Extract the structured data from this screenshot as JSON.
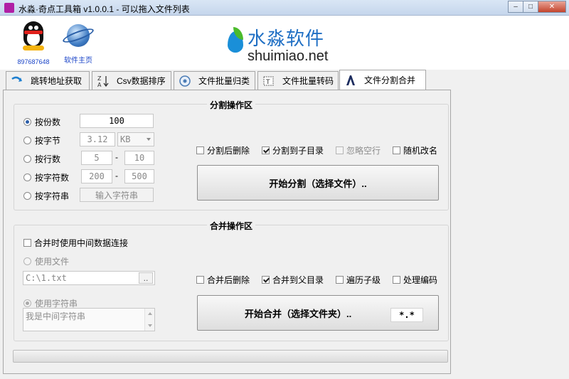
{
  "window": {
    "title": "水淼·奇点工具箱 v1.0.0.1 - 可以拖入文件列表",
    "minimize_symbol": "–",
    "maximize_symbol": "□",
    "close_symbol": "✕"
  },
  "header": {
    "qq_label": "897687648",
    "homepage_label": "软件主页",
    "brand_cn": "水淼软件",
    "brand_en": "shuimiao.net"
  },
  "tabs": [
    {
      "label": "跳转地址获取",
      "icon": "redirect-arrow-icon"
    },
    {
      "label": "Csv数据排序",
      "icon": "sort-az-icon"
    },
    {
      "label": "文件批量归类",
      "icon": "classify-icon"
    },
    {
      "label": "文件批量转码",
      "icon": "transcode-icon"
    },
    {
      "label": "文件分割合并",
      "icon": "split-merge-icon",
      "active": true
    }
  ],
  "split": {
    "title": "分割操作区",
    "by_count": {
      "label": "按份数",
      "value": "100"
    },
    "by_bytes": {
      "label": "按字节",
      "value": "3.12",
      "unit": "KB"
    },
    "by_lines": {
      "label": "按行数",
      "from": "5",
      "to": "10"
    },
    "by_chars": {
      "label": "按字符数",
      "from": "200",
      "to": "500"
    },
    "by_string": {
      "label": "按字符串",
      "button": "输入字符串"
    },
    "range_sep": "-",
    "options": {
      "delete_after": "分割后删除",
      "to_subdir": "分割到子目录",
      "ignore_blank": "忽略空行",
      "random_rename": "随机改名"
    },
    "start_button": "开始分割（选择文件）.."
  },
  "merge": {
    "title": "合并操作区",
    "use_middle": "合并时使用中间数据连接",
    "use_file": "使用文件",
    "file_path": "C:\\1.txt",
    "browse_button": "..",
    "use_string": "使用字符串",
    "middle_string": "我是中间字符串",
    "options": {
      "delete_after": "合并后删除",
      "to_parent": "合并到父目录",
      "traverse_sub": "遍历子级",
      "handle_encoding": "处理编码"
    },
    "start_button": "开始合并（选择文件夹）..",
    "filter": "*.*"
  },
  "progress": {
    "value": 0
  }
}
